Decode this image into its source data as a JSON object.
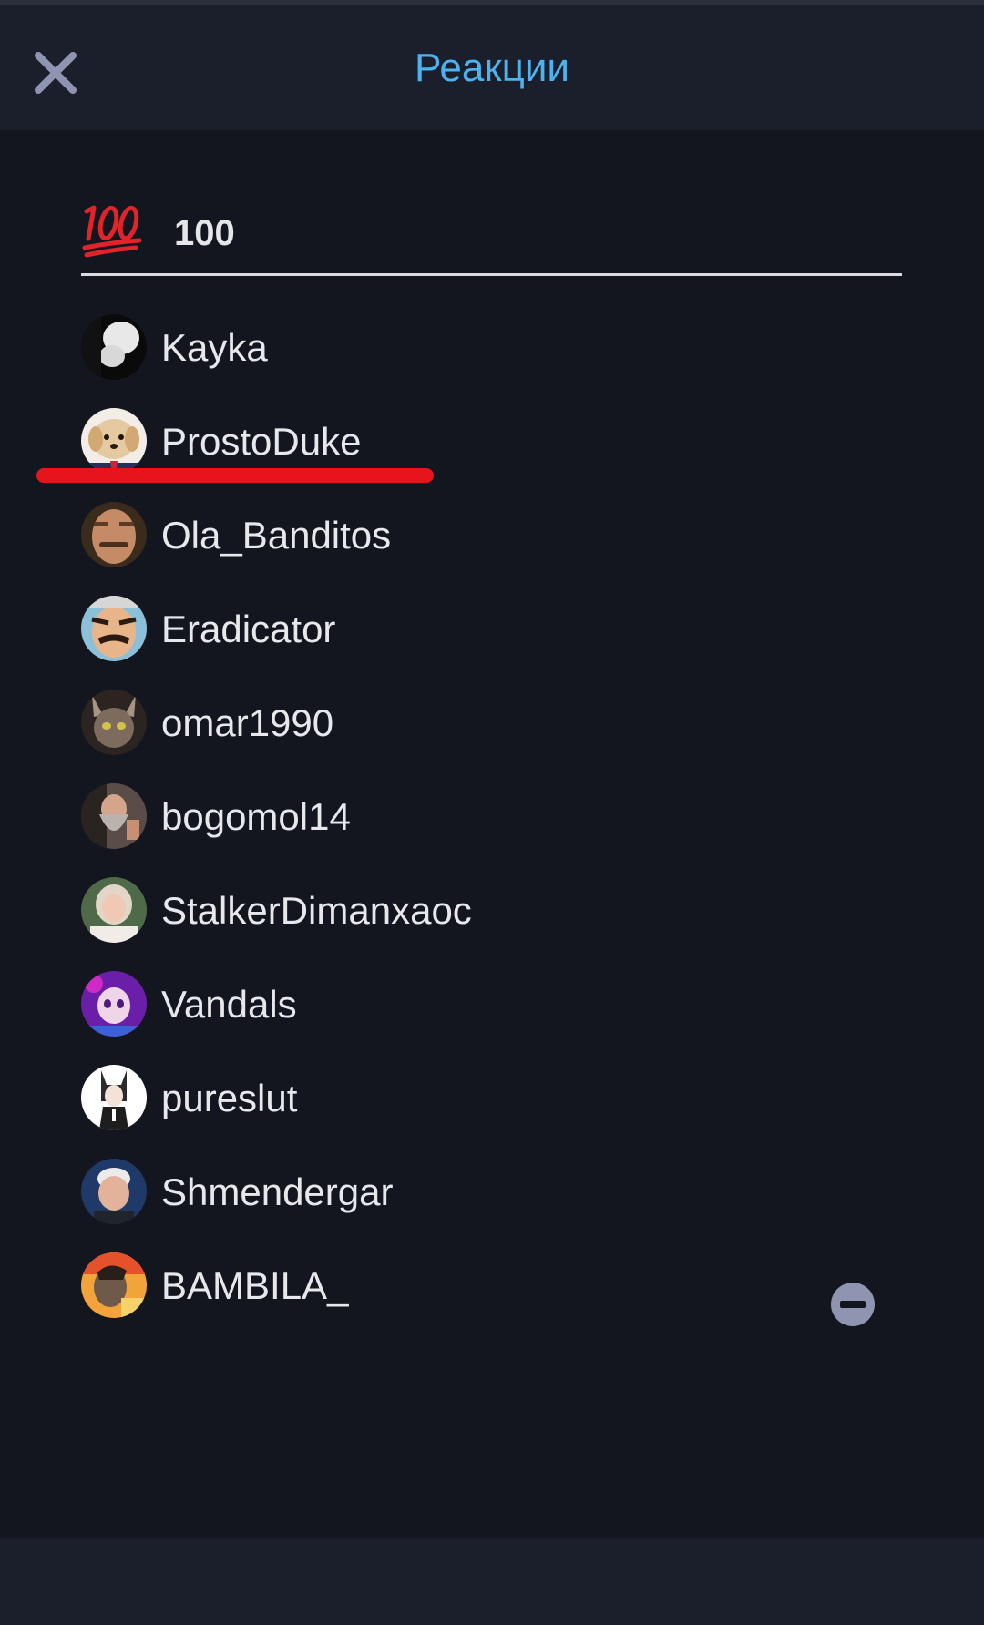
{
  "header": {
    "title": "Реакции",
    "close_icon": "close-icon",
    "title_color": "#4cb2f0"
  },
  "reaction": {
    "emoji_icon": "hundred-points-emoji",
    "count": "100"
  },
  "users": [
    {
      "name": "Kayka"
    },
    {
      "name": "ProstoDuke"
    },
    {
      "name": "Ola_Banditos"
    },
    {
      "name": "Eradicator"
    },
    {
      "name": "omar1990"
    },
    {
      "name": "bogomol14"
    },
    {
      "name": "StalkerDimanxaoc"
    },
    {
      "name": "Vandals"
    },
    {
      "name": "pureslut"
    },
    {
      "name": "Shmendergar"
    },
    {
      "name": "BAMBILA_"
    }
  ],
  "annotation": {
    "color": "#e8141c",
    "target": "ProstoDuke"
  },
  "remove_icon": "minus-circle-icon",
  "colors": {
    "background": "#13161f",
    "header_bg": "#1b1f2b",
    "text": "#e6e8ec"
  }
}
